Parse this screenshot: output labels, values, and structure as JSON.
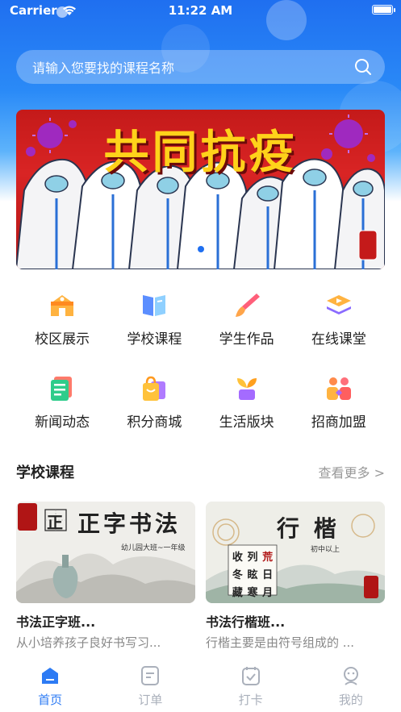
{
  "status_bar": {
    "carrier": "Carrier",
    "time": "11:22 AM",
    "battery_level": 1.0
  },
  "search": {
    "placeholder": "请输入您要找的课程名称"
  },
  "banner": {
    "title": "共同抗疫",
    "slide_count": 3,
    "active_slide": 2
  },
  "shortcuts": [
    {
      "label": "校区展示",
      "icon": "campus-icon",
      "color": "#ff9f2e"
    },
    {
      "label": "学校课程",
      "icon": "book-icon",
      "color": "#4f8bff"
    },
    {
      "label": "学生作品",
      "icon": "brush-icon",
      "color": "#ff5f5f"
    },
    {
      "label": "在线课堂",
      "icon": "layers-play-icon",
      "color": "#ff9f2e"
    },
    {
      "label": "新闻动态",
      "icon": "news-icon",
      "color": "#2ecc8b"
    },
    {
      "label": "积分商城",
      "icon": "shopping-bag-icon",
      "color": "#ffb72e"
    },
    {
      "label": "生活版块",
      "icon": "sprout-icon",
      "color": "#a46bff"
    },
    {
      "label": "招商加盟",
      "icon": "partners-icon",
      "color": "#ff6f4f"
    }
  ],
  "section": {
    "title": "学校课程",
    "more_label": "查看更多 >"
  },
  "courses": [
    {
      "title": "书法正字班...",
      "description": "从小培养孩子良好书写习...",
      "image_heading": "正字书法",
      "image_char": "正",
      "image_tag": "幼儿园大班~一年级"
    },
    {
      "title": "书法行楷班...",
      "description": "行楷主要是由符号组成的 ...",
      "image_heading": "行 楷",
      "image_grid": [
        "收",
        "列",
        "荒",
        "冬",
        "眩",
        "日",
        "藏",
        "寒",
        "月"
      ],
      "image_tag": "初中以上"
    }
  ],
  "tabs": [
    {
      "label": "首页",
      "icon": "home-icon",
      "active": true
    },
    {
      "label": "订单",
      "icon": "order-icon",
      "active": false
    },
    {
      "label": "打卡",
      "icon": "checkin-icon",
      "active": false
    },
    {
      "label": "我的",
      "icon": "profile-icon",
      "active": false
    }
  ],
  "colors": {
    "primary": "#2d7bf4",
    "inactive_tab": "#aab0bb",
    "banner_red": "#c41a1a",
    "banner_yellow": "#ffd21a"
  }
}
